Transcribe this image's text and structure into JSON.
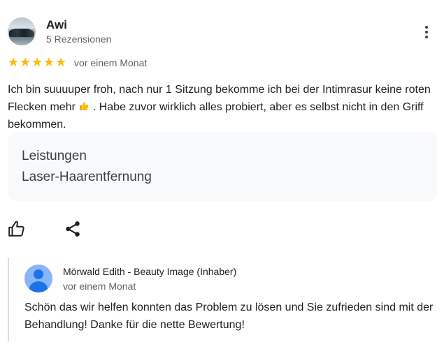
{
  "reviewer": {
    "name": "Awi",
    "review_count": "5 Rezensionen",
    "rating_stars": 5,
    "date": "vor einem Monat"
  },
  "review": {
    "text_before_emoji": "Ich bin suuuuper froh, nach nur 1 Sitzung bekomme ich bei der Intimrasur keine roten Flecken mehr ",
    "emoji": "thumbs-up-emoji",
    "text_after_emoji": " . Habe zuvor wirklich alles probiert, aber es selbst nicht in den Griff bekommen."
  },
  "services": {
    "title": "Leistungen",
    "value": "Laser-Haarentfernung"
  },
  "actions": {
    "like_icon": "thumbs-up-outline-icon",
    "share_icon": "share-icon",
    "more_icon": "more-vert-icon"
  },
  "owner_reply": {
    "name": "Mörwald Edith - Beauty Image (Inhaber)",
    "date": "vor einem Monat",
    "text": "Schön das wir helfen konnten das Problem zu lösen und Sie zufrieden sind mit der Behandlung! Danke für die nette Bewertung!"
  },
  "colors": {
    "star": "#fbbc04",
    "secondary_text": "#5f6368",
    "services_background": "#f8f9fa",
    "owner_avatar": "#8ab4f8"
  }
}
